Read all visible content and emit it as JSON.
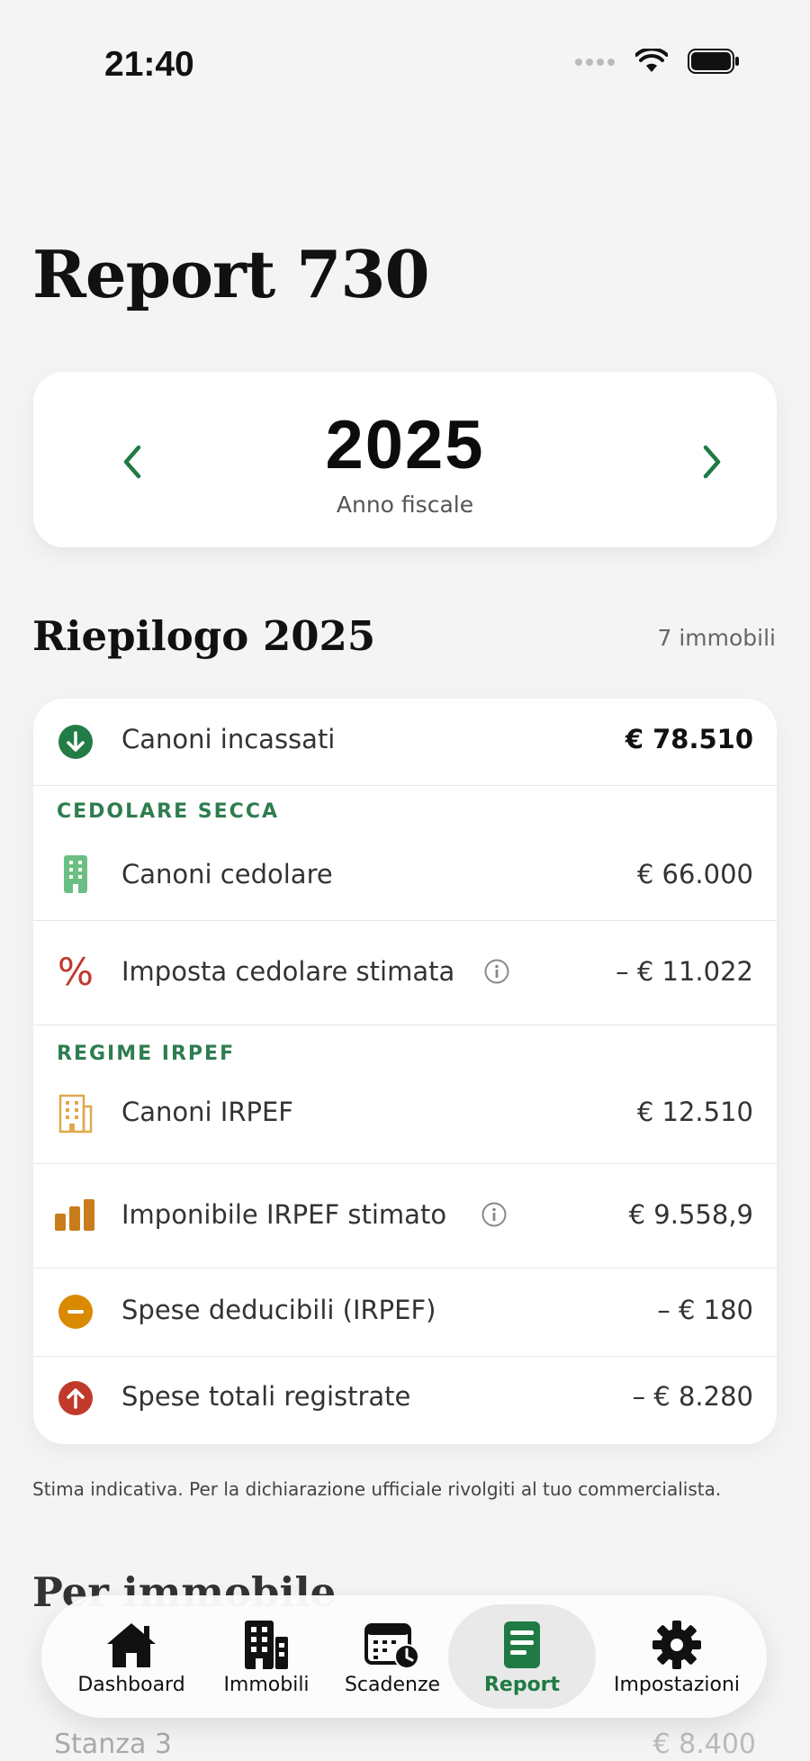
{
  "status": {
    "time": "21:40"
  },
  "page": {
    "title": "Report 730"
  },
  "year_selector": {
    "year": "2025",
    "caption": "Anno fiscale"
  },
  "summary": {
    "title": "Riepilogo 2025",
    "count": "7 immobili",
    "rows": [
      {
        "label": "Canoni incassati",
        "value": "€ 78.510",
        "icon": "arrow-down-circle-icon"
      },
      {
        "label": "Canoni cedolare",
        "value": "€ 66.000",
        "icon": "building-icon"
      },
      {
        "label": "Imposta cedolare stimata",
        "value": "– € 11.022",
        "icon": "percent-icon"
      },
      {
        "label": "Canoni IRPEF",
        "value": "€ 12.510",
        "icon": "building-outline-icon"
      },
      {
        "label": "Imponibile IRPEF stimato",
        "value": "€ 9.558,9",
        "icon": "bar-chart-icon"
      },
      {
        "label": "Spese deducibili (IRPEF)",
        "value": "– € 180",
        "icon": "minus-circle-icon"
      },
      {
        "label": "Spese totali registrate",
        "value": "– € 8.280",
        "icon": "arrow-up-circle-icon"
      }
    ],
    "groups": {
      "cedolare": "CEDOLARE SECCA",
      "irpef": "REGIME IRPEF"
    }
  },
  "disclaimer": "Stima indicativa. Per la dichiarazione ufficiale rivolgiti al tuo commercialista.",
  "per_immobile": {
    "title": "Per immobile",
    "row_label": "Stanza 3",
    "row_value": "€ 8.400"
  },
  "tabs": [
    {
      "label": "Dashboard",
      "icon": "house-icon"
    },
    {
      "label": "Immobili",
      "icon": "building-icon"
    },
    {
      "label": "Scadenze",
      "icon": "calendar-clock-icon"
    },
    {
      "label": "Report",
      "icon": "document-icon",
      "active": true
    },
    {
      "label": "Impostazioni",
      "icon": "gear-icon"
    }
  ],
  "colors": {
    "accent": "#1f7a44",
    "danger": "#c0392b",
    "warning": "#d98a00",
    "orange": "#c97c1b"
  }
}
